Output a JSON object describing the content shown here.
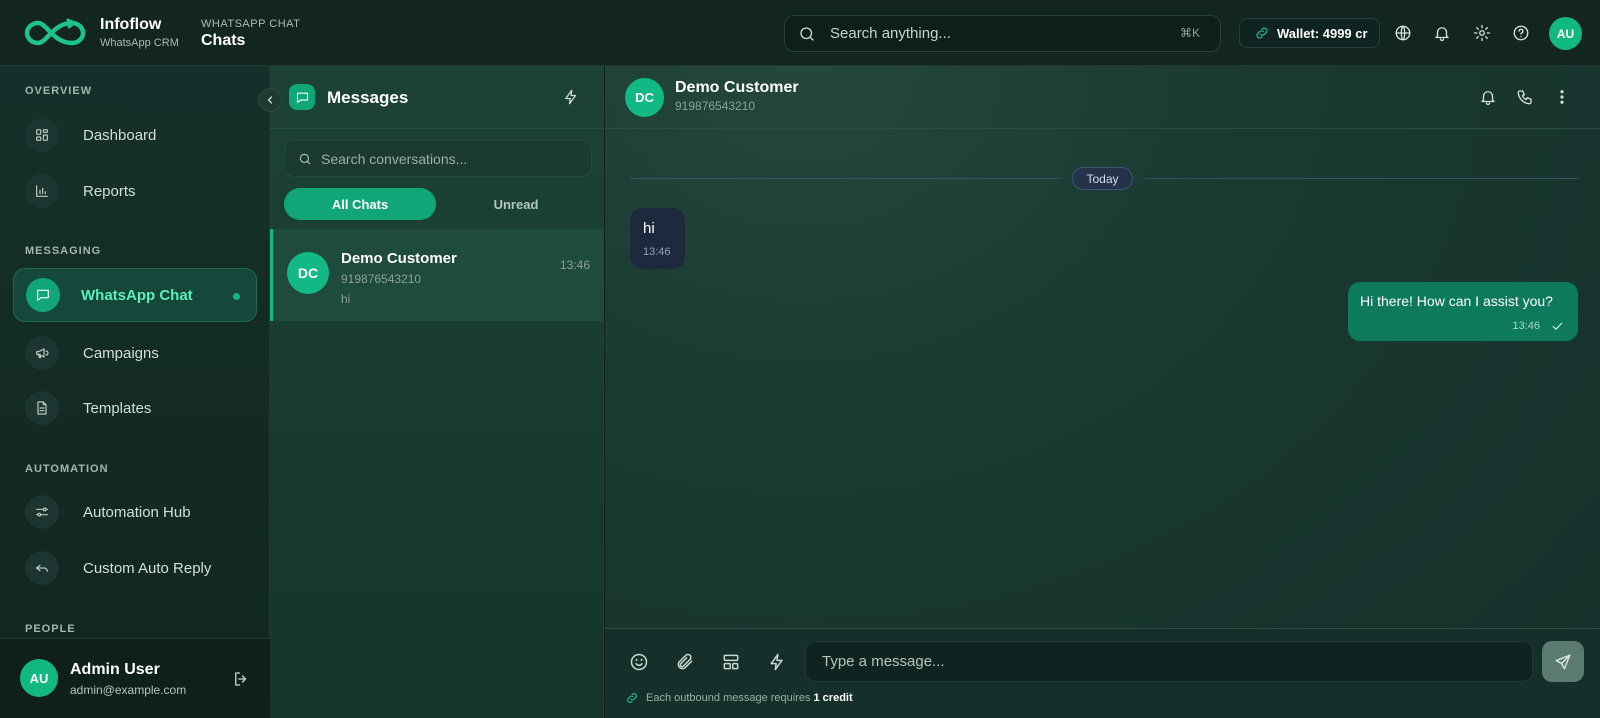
{
  "brand": {
    "name": "Infoflow",
    "subtitle": "WhatsApp CRM"
  },
  "breadcrumb": {
    "section": "WHATSAPP CHAT",
    "title": "Chats"
  },
  "top_search": {
    "placeholder": "Search anything...",
    "shortcut": "⌘K"
  },
  "wallet": {
    "label": "Wallet: 4999 cr"
  },
  "header_user": {
    "initials": "AU"
  },
  "sidebar": {
    "sections": [
      {
        "label": "OVERVIEW"
      },
      {
        "label": "MESSAGING"
      },
      {
        "label": "AUTOMATION"
      },
      {
        "label": "PEOPLE"
      }
    ],
    "items": [
      {
        "label": "Dashboard",
        "icon": "grid-icon"
      },
      {
        "label": "Reports",
        "icon": "bar-chart-icon"
      },
      {
        "label": "WhatsApp Chat",
        "icon": "message-icon",
        "active": true
      },
      {
        "label": "Campaigns",
        "icon": "megaphone-icon"
      },
      {
        "label": "Templates",
        "icon": "document-icon"
      },
      {
        "label": "Automation Hub",
        "icon": "sliders-icon"
      },
      {
        "label": "Custom Auto Reply",
        "icon": "reply-icon"
      }
    ],
    "user": {
      "initials": "AU",
      "name": "Admin User",
      "email": "admin@example.com"
    }
  },
  "conversations": {
    "title": "Messages",
    "search_placeholder": "Search conversations...",
    "tabs": [
      {
        "label": "All Chats",
        "active": true
      },
      {
        "label": "Unread",
        "active": false
      }
    ],
    "items": [
      {
        "initials": "DC",
        "name": "Demo Customer",
        "phone": "919876543210",
        "preview": "hi",
        "time": "13:46"
      }
    ]
  },
  "chat": {
    "contact": {
      "initials": "DC",
      "name": "Demo Customer",
      "phone": "919876543210"
    },
    "day_label": "Today",
    "messages": [
      {
        "direction": "in",
        "text": "hi",
        "time": "13:46"
      },
      {
        "direction": "out",
        "text": "Hi there! How can I assist you?",
        "time": "13:46"
      }
    ],
    "composer": {
      "placeholder": "Type a message...",
      "note": "Each outbound message requires",
      "note_value": "1 credit"
    }
  },
  "colors": {
    "accent": "#11b981",
    "accent_text": "#5cefb8",
    "outgoing_bubble": "#0c7a5b",
    "incoming_bubble": "#1d2a3e"
  }
}
